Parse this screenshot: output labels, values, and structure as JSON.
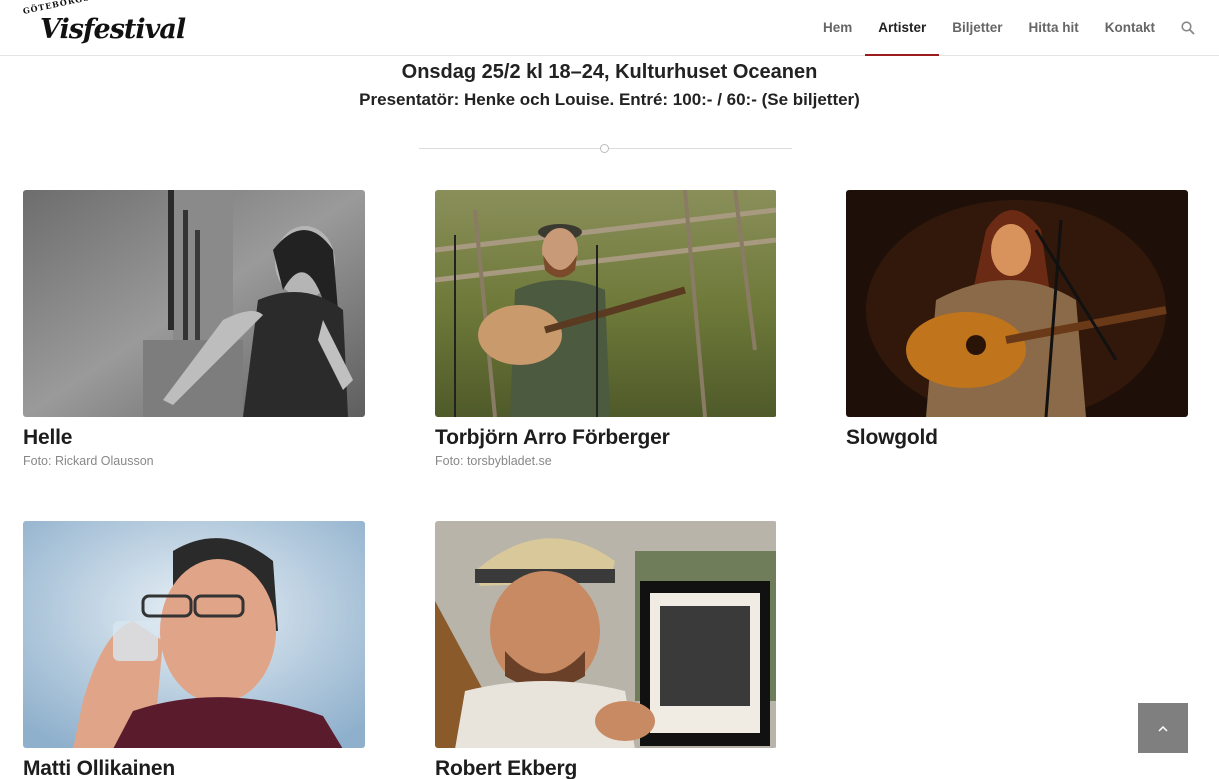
{
  "logo": {
    "top_text": "GÖTEBORGS",
    "main_text": "Visfestival"
  },
  "nav": {
    "items": [
      {
        "label": "Hem"
      },
      {
        "label": "Artister"
      },
      {
        "label": "Biljetter"
      },
      {
        "label": "Hitta hit"
      },
      {
        "label": "Kontakt"
      }
    ],
    "active": "Artister",
    "search_icon": "search-icon"
  },
  "event": {
    "title": "Onsdag 25/2 kl 18–24, Kulturhuset Oceanen",
    "subtitle": "Presentatör: Henke och Louise. Entré: 100:- / 60:- (Se biljetter)"
  },
  "artists": [
    {
      "name": "Helle",
      "credit": "Foto: Rickard Olausson"
    },
    {
      "name": "Torbjörn Arro Förberger",
      "credit": "Foto: torsbybladet.se"
    },
    {
      "name": "Slowgold",
      "credit": ""
    },
    {
      "name": "Matti Ollikainen",
      "credit": ""
    },
    {
      "name": "Robert Ekberg",
      "credit": ""
    }
  ],
  "colors": {
    "accent": "#9b1c1c",
    "scroll_button": "#7f7f7f"
  },
  "scroll_top_icon": "chevron-up-icon"
}
